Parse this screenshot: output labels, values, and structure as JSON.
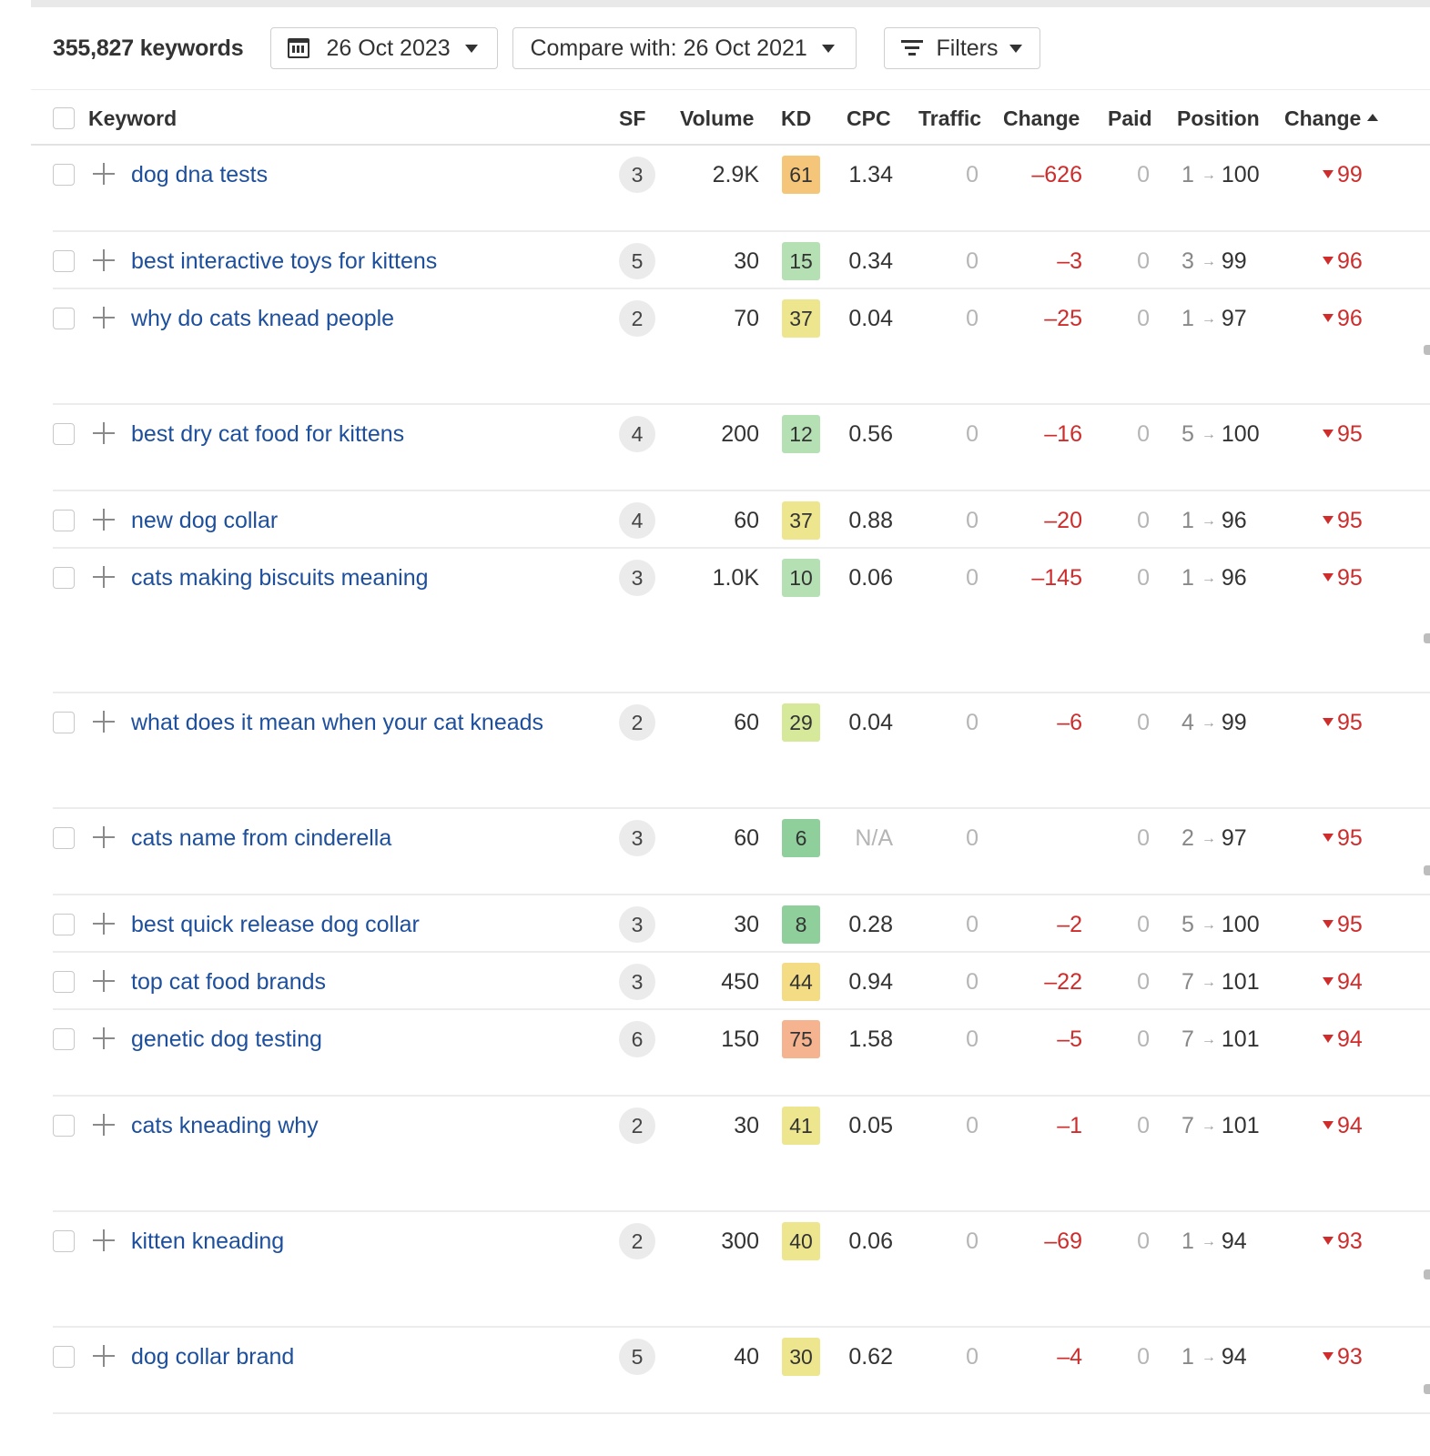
{
  "toolbar": {
    "keywords_count": "355,827 keywords",
    "date_label": "26 Oct 2023",
    "compare_label": "Compare with: 26 Oct 2021",
    "filters_label": "Filters"
  },
  "columns": {
    "keyword": "Keyword",
    "sf": "SF",
    "volume": "Volume",
    "kd": "KD",
    "cpc": "CPC",
    "traffic": "Traffic",
    "traffic_change": "Change",
    "paid": "Paid",
    "position": "Position",
    "position_change": "Change"
  },
  "kd_colors": {
    "very_easy": "#8ecf9c",
    "easy": "#b4e0b4",
    "medium": "#ede68f",
    "hard": "#f5c67a",
    "very_hard": "#f5b38f"
  },
  "rows": [
    {
      "keyword": "dog dna tests",
      "sf": "3",
      "volume": "2.9K",
      "kd": "61",
      "kd_color": "#f5c67a",
      "cpc": "1.34",
      "traffic": "0",
      "change": "–626",
      "paid": "0",
      "pos_from": "1",
      "pos_to": "100",
      "pos_change": "99"
    },
    {
      "keyword": "best interactive toys for kittens",
      "sf": "5",
      "volume": "30",
      "kd": "15",
      "kd_color": "#b4e0b4",
      "cpc": "0.34",
      "traffic": "0",
      "change": "–3",
      "paid": "0",
      "pos_from": "3",
      "pos_to": "99",
      "pos_change": "96"
    },
    {
      "keyword": "why do cats knead people",
      "sf": "2",
      "volume": "70",
      "kd": "37",
      "kd_color": "#ede68f",
      "cpc": "0.04",
      "traffic": "0",
      "change": "–25",
      "paid": "0",
      "pos_from": "1",
      "pos_to": "97",
      "pos_change": "96"
    },
    {
      "keyword": "best dry cat food for kittens",
      "sf": "4",
      "volume": "200",
      "kd": "12",
      "kd_color": "#b4e0b4",
      "cpc": "0.56",
      "traffic": "0",
      "change": "–16",
      "paid": "0",
      "pos_from": "5",
      "pos_to": "100",
      "pos_change": "95"
    },
    {
      "keyword": "new dog collar",
      "sf": "4",
      "volume": "60",
      "kd": "37",
      "kd_color": "#ede68f",
      "cpc": "0.88",
      "traffic": "0",
      "change": "–20",
      "paid": "0",
      "pos_from": "1",
      "pos_to": "96",
      "pos_change": "95"
    },
    {
      "keyword": "cats making biscuits meaning",
      "sf": "3",
      "volume": "1.0K",
      "kd": "10",
      "kd_color": "#b4e0b4",
      "cpc": "0.06",
      "traffic": "0",
      "change": "–145",
      "paid": "0",
      "pos_from": "1",
      "pos_to": "96",
      "pos_change": "95"
    },
    {
      "keyword": "what does it mean when your cat kneads",
      "sf": "2",
      "volume": "60",
      "kd": "29",
      "kd_color": "#d6e89a",
      "cpc": "0.04",
      "traffic": "0",
      "change": "–6",
      "paid": "0",
      "pos_from": "4",
      "pos_to": "99",
      "pos_change": "95"
    },
    {
      "keyword": "cats name from cinderella",
      "sf": "3",
      "volume": "60",
      "kd": "6",
      "kd_color": "#8ecf9c",
      "cpc": "N/A",
      "traffic": "0",
      "change": "",
      "paid": "0",
      "pos_from": "2",
      "pos_to": "97",
      "pos_change": "95"
    },
    {
      "keyword": "best quick release dog collar",
      "sf": "3",
      "volume": "30",
      "kd": "8",
      "kd_color": "#8ecf9c",
      "cpc": "0.28",
      "traffic": "0",
      "change": "–2",
      "paid": "0",
      "pos_from": "5",
      "pos_to": "100",
      "pos_change": "95"
    },
    {
      "keyword": "top cat food brands",
      "sf": "3",
      "volume": "450",
      "kd": "44",
      "kd_color": "#f3dc84",
      "cpc": "0.94",
      "traffic": "0",
      "change": "–22",
      "paid": "0",
      "pos_from": "7",
      "pos_to": "101",
      "pos_change": "94"
    },
    {
      "keyword": "genetic dog testing",
      "sf": "6",
      "volume": "150",
      "kd": "75",
      "kd_color": "#f5b38f",
      "cpc": "1.58",
      "traffic": "0",
      "change": "–5",
      "paid": "0",
      "pos_from": "7",
      "pos_to": "101",
      "pos_change": "94"
    },
    {
      "keyword": "cats kneading why",
      "sf": "2",
      "volume": "30",
      "kd": "41",
      "kd_color": "#ede68f",
      "cpc": "0.05",
      "traffic": "0",
      "change": "–1",
      "paid": "0",
      "pos_from": "7",
      "pos_to": "101",
      "pos_change": "94"
    },
    {
      "keyword": "kitten kneading",
      "sf": "2",
      "volume": "300",
      "kd": "40",
      "kd_color": "#ede68f",
      "cpc": "0.06",
      "traffic": "0",
      "change": "–69",
      "paid": "0",
      "pos_from": "1",
      "pos_to": "94",
      "pos_change": "93"
    },
    {
      "keyword": "dog collar brand",
      "sf": "5",
      "volume": "40",
      "kd": "30",
      "kd_color": "#ede68f",
      "cpc": "0.62",
      "traffic": "0",
      "change": "–4",
      "paid": "0",
      "pos_from": "1",
      "pos_to": "94",
      "pos_change": "93"
    }
  ]
}
